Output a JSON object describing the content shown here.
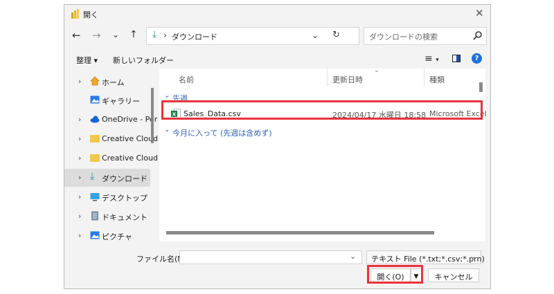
{
  "title": "開く",
  "nav": {
    "path_arrow": "›",
    "path_label": "ダウンロード",
    "search_placeholder": "ダウンロードの検索"
  },
  "toolbar": {
    "organize": "整理 ▾",
    "new_folder": "新しいフォルダー",
    "help": "?"
  },
  "sidebar": {
    "items": [
      {
        "label": "ホーム",
        "icon": "home-icon"
      },
      {
        "label": "ギャラリー",
        "icon": "gallery-icon"
      },
      {
        "label": "OneDrive - Per",
        "icon": "cloud-icon"
      },
      {
        "label": "Creative Cloud",
        "icon": "folder-icon"
      },
      {
        "label": "Creative Cloud",
        "icon": "folder-icon"
      },
      {
        "label": "ダウンロード",
        "icon": "download-icon"
      },
      {
        "label": "デスクトップ",
        "icon": "desktop-icon"
      },
      {
        "label": "ドキュメント",
        "icon": "document-icon"
      },
      {
        "label": "ピクチャ",
        "icon": "picture-icon"
      }
    ]
  },
  "columns": {
    "name": "名前",
    "modified": "更新日時",
    "type": "種類"
  },
  "groups": {
    "last_week": "先週",
    "this_month": "今月に入って (先週は含めず)"
  },
  "file": {
    "name": "Sales_Data.csv",
    "modified": "2024/04/17 水曜日 18:58",
    "type": "Microsoft Excel"
  },
  "footer": {
    "filename_label": "ファイル名(N):",
    "filename_value": "",
    "filetype": "テキスト File (*.txt;*.csv;*.prn)",
    "open": "開く(O)",
    "cancel": "キャンセル"
  },
  "colors": {
    "highlight": "#e8323b",
    "selected_sidebar": "#dcdcdc",
    "excel_green": "#1d7a45"
  }
}
